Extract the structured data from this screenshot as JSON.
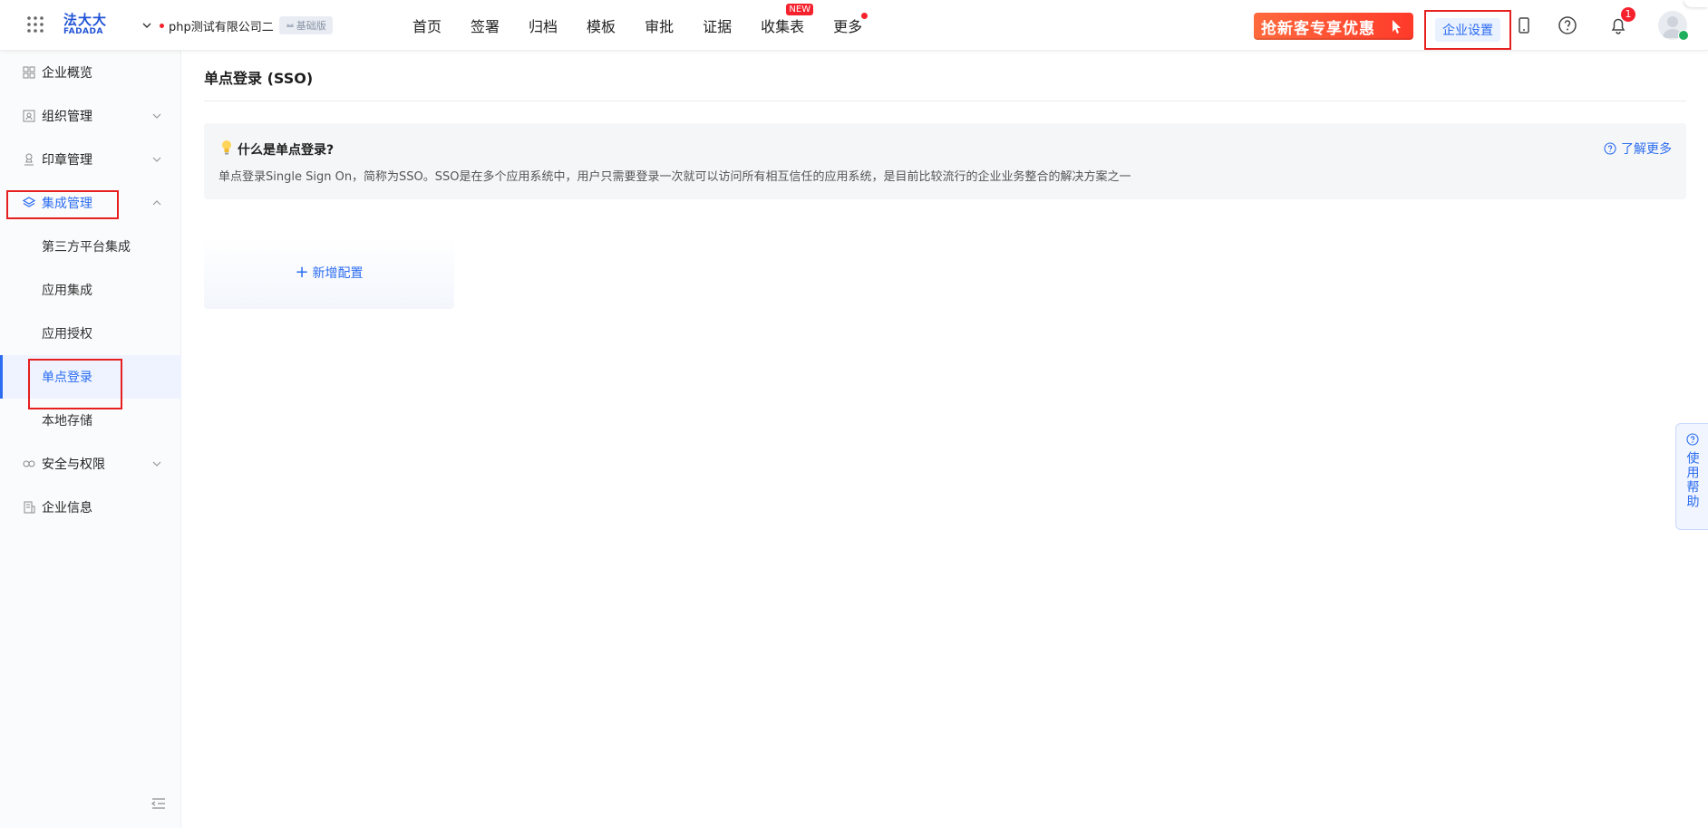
{
  "brand": {
    "logo_cn": "法大大",
    "logo_en": "FADADA",
    "accent": "#2b6cf0",
    "alert": "#e61f1f"
  },
  "company": {
    "name": "php测试有限公司二",
    "plan_badge": "基础版"
  },
  "nav": {
    "items": [
      {
        "label": "首页"
      },
      {
        "label": "签署"
      },
      {
        "label": "归档"
      },
      {
        "label": "模板"
      },
      {
        "label": "审批"
      },
      {
        "label": "证据"
      },
      {
        "label": "收集表",
        "tag": "NEW"
      },
      {
        "label": "更多"
      }
    ]
  },
  "topbar": {
    "promo_label": "抢新客专享优惠",
    "enterprise_settings": "企业设置",
    "notification_count": "1",
    "icons": [
      "grid-icon",
      "phone-icon",
      "help-icon",
      "bell-icon",
      "avatar"
    ]
  },
  "sidebar": {
    "items": [
      {
        "label": "企业概览",
        "icon": "overview-icon"
      },
      {
        "label": "组织管理",
        "icon": "org-icon"
      },
      {
        "label": "印章管理",
        "icon": "seal-icon"
      },
      {
        "label": "集成管理",
        "icon": "layers-icon"
      },
      {
        "label": "安全与权限",
        "icon": "link-icon"
      },
      {
        "label": "企业信息",
        "icon": "building-icon"
      }
    ],
    "sub_items": [
      {
        "label": "第三方平台集成"
      },
      {
        "label": "应用集成"
      },
      {
        "label": "应用授权"
      },
      {
        "label": "单点登录",
        "active": true
      },
      {
        "label": "本地存储"
      }
    ]
  },
  "main": {
    "title": "单点登录 (SSO)",
    "info": {
      "title": "什么是单点登录?",
      "description": "单点登录Single Sign On，简称为SSO。SSO是在多个应用系统中，用户只需要登录一次就可以访问所有相互信任的应用系统，是目前比较流行的企业业务整合的解决方案之一",
      "learn_more": "了解更多"
    },
    "add_config": "新增配置"
  },
  "help_tab": {
    "label": "使用帮助"
  }
}
